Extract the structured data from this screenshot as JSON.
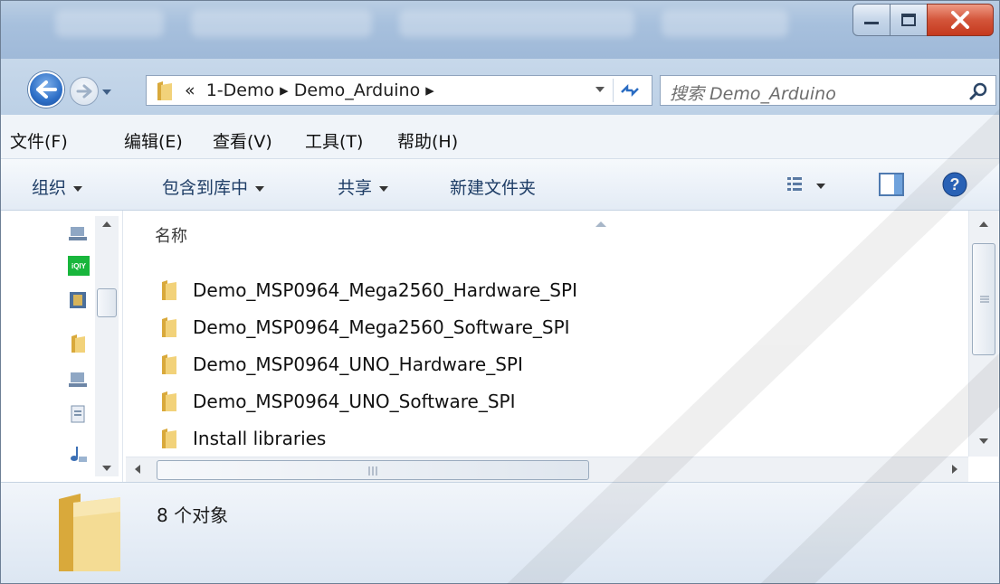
{
  "window": {
    "controls": {
      "minimize": "minimize",
      "maximize": "maximize",
      "close": "close"
    }
  },
  "address_bar": {
    "path_prefix": "«",
    "crumbs": [
      "1-Demo",
      "Demo_Arduino"
    ],
    "search_placeholder": "搜索 Demo_Arduino"
  },
  "menu": {
    "items": [
      "文件(F)",
      "编辑(E)",
      "查看(V)",
      "工具(T)",
      "帮助(H)"
    ]
  },
  "toolbar": {
    "organize": "组织",
    "include_library": "包含到库中",
    "share": "共享",
    "new_folder": "新建文件夹"
  },
  "file_list": {
    "column_name": "名称",
    "items": [
      "Demo_MSP0964_Mega2560_Hardware_SPI",
      "Demo_MSP0964_Mega2560_Software_SPI",
      "Demo_MSP0964_UNO_Hardware_SPI",
      "Demo_MSP0964_UNO_Software_SPI",
      "Install libraries"
    ]
  },
  "nav_pane": {
    "iqiyi_label": "iQIY"
  },
  "status": {
    "count_text": "8 个对象"
  },
  "icons": {
    "folder": "folder-icon",
    "search": "search-icon",
    "help": "help-icon",
    "view": "view-options-icon",
    "preview": "preview-pane-icon"
  },
  "colors": {
    "folder": "#e8c15a",
    "close_button": "#c5391e",
    "toolbar_text": "#1e3d66"
  }
}
